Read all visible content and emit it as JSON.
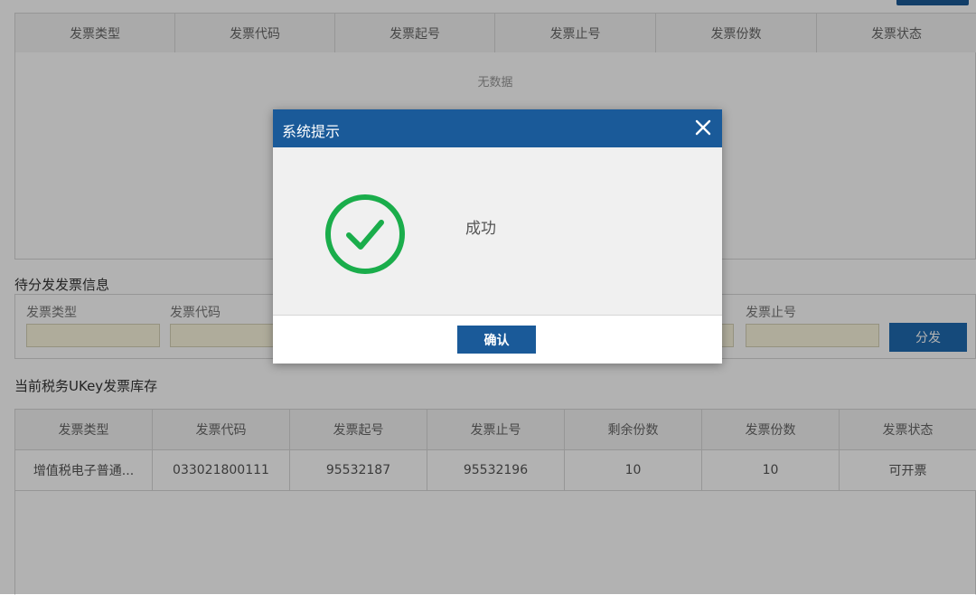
{
  "issued_table": {
    "headers": [
      "发票类型",
      "发票代码",
      "发票起号",
      "发票止号",
      "发票份数",
      "发票状态"
    ],
    "empty_text": "无数据"
  },
  "distribute": {
    "title": "待分发发票信息",
    "labels": {
      "type": "发票类型",
      "code": "发票代码",
      "end": "发票止号"
    },
    "button_label": "分发"
  },
  "stock": {
    "title": "当前税务UKey发票库存",
    "headers": [
      "发票类型",
      "发票代码",
      "发票起号",
      "发票止号",
      "剩余份数",
      "发票份数",
      "发票状态"
    ],
    "rows": [
      [
        "增值税电子普通...",
        "033021800111",
        "95532187",
        "95532196",
        "10",
        "10",
        "可开票"
      ]
    ]
  },
  "modal": {
    "title": "系统提示",
    "message": "成功",
    "confirm_label": "确认",
    "icon": "success-check-icon",
    "icon_color": "#1aad4b",
    "header_color": "#1a5a99"
  }
}
